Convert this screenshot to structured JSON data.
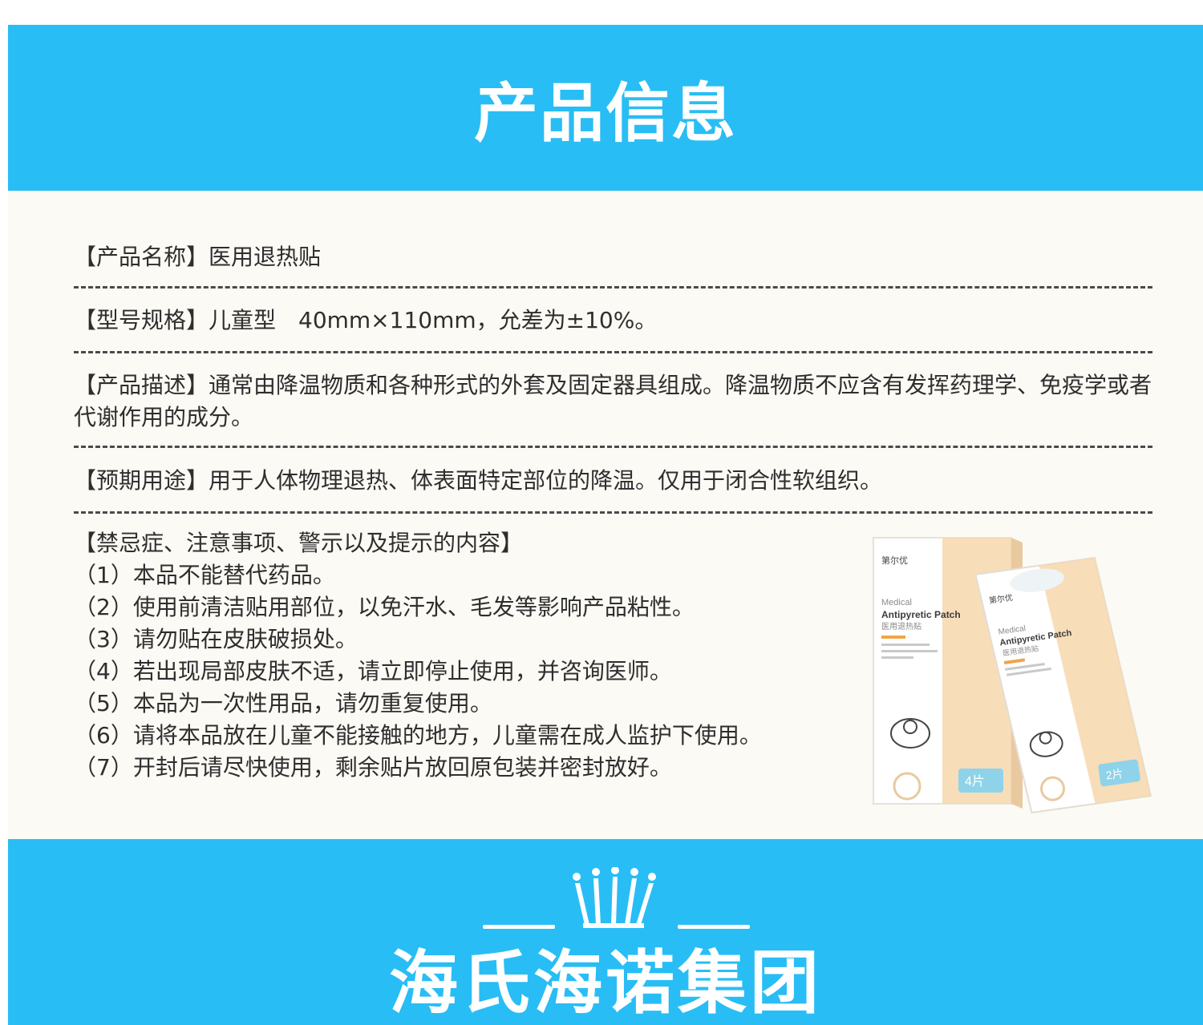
{
  "header": {
    "title": "产品信息"
  },
  "info": {
    "name": "【产品名称】医用退热贴",
    "model": "【型号规格】儿童型　40mm×110mm，允差为±10%。",
    "description": "【产品描述】通常由降温物质和各种形式的外套及固定器具组成。降温物质不应含有发挥药理学、免疫学或者代谢作用的成分。",
    "usage": "【预期用途】用于人体物理退热、体表面特定部位的降温。仅用于闭合性软组织。"
  },
  "warnings": {
    "title": "【禁忌症、注意事项、警示以及提示的内容】",
    "items": [
      "（1）本品不能替代药品。",
      "（2）使用前清洁贴用部位，以免汗水、毛发等影响产品粘性。",
      "（3）请勿贴在皮肤破损处。",
      "（4）若出现局部皮肤不适，请立即停止使用，并咨询医师。",
      "（5）本品为一次性用品，请勿重复使用。",
      "（6）请将本品放在儿童不能接触的地方，儿童需在成人监护下使用。",
      "（7）开封后请尽快使用，剩余贴片放回原包装并密封放好。"
    ]
  },
  "product_image": {
    "box_brand": "第尔优",
    "box_line1": "Medical",
    "box_line2": "Antipyretic Patch",
    "box_line3": "医用退热贴",
    "box_count": "4片",
    "pouch_brand": "第尔优",
    "pouch_line1": "Medical",
    "pouch_line2": "Antipyretic Patch",
    "pouch_line3": "医用退热贴",
    "pouch_count": "2片"
  },
  "footer": {
    "brand": "海氏海诺集团"
  },
  "colors": {
    "accent": "#29bdf5",
    "panel": "#fcfaf4",
    "text": "#2e2e2e"
  }
}
